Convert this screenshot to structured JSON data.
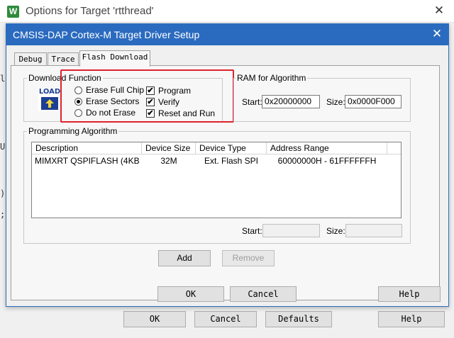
{
  "outer_window": {
    "title": "Options for Target 'rtthread'",
    "icon_letter": "W",
    "buttons": {
      "ok": "OK",
      "cancel": "Cancel",
      "defaults": "Defaults",
      "help": "Help"
    }
  },
  "dialog": {
    "title": "CMSIS-DAP Cortex-M Target Driver Setup",
    "tabs": [
      {
        "label": "Debug",
        "active": false
      },
      {
        "label": "Trace",
        "active": false
      },
      {
        "label": "Flash Download",
        "active": true
      }
    ],
    "download_function": {
      "group_label": "Download Function",
      "icon_text": "LOAD",
      "radios": [
        {
          "label": "Erase Full Chip",
          "selected": false
        },
        {
          "label": "Erase Sectors",
          "selected": true
        },
        {
          "label": "Do not Erase",
          "selected": false
        }
      ],
      "checkboxes": [
        {
          "label": "Program",
          "checked": true
        },
        {
          "label": "Verify",
          "checked": true
        },
        {
          "label": "Reset and Run",
          "checked": true
        }
      ]
    },
    "ram_for_algorithm": {
      "group_label": "RAM for Algorithm",
      "start_label": "Start:",
      "start_value": "0x20000000",
      "size_label": "Size:",
      "size_value": "0x0000F000"
    },
    "programming_algorithm": {
      "group_label": "Programming Algorithm",
      "columns": [
        "Description",
        "Device Size",
        "Device Type",
        "Address Range"
      ],
      "rows": [
        {
          "description": "MIMXRT QSPIFLASH (4KB ...",
          "device_size": "32M",
          "device_type": "Ext. Flash SPI",
          "address_range": "60000000H - 61FFFFFFH"
        }
      ],
      "start_label": "Start:",
      "start_value": "",
      "size_label": "Size:",
      "size_value": ""
    },
    "add_button": "Add",
    "remove_button": "Remove",
    "buttons": {
      "ok": "OK",
      "cancel": "Cancel",
      "help": "Help"
    }
  },
  "colors": {
    "dialog_titlebar": "#2b6bbf",
    "highlight": "#e0212e",
    "app_icon": "#2e8b3a"
  }
}
